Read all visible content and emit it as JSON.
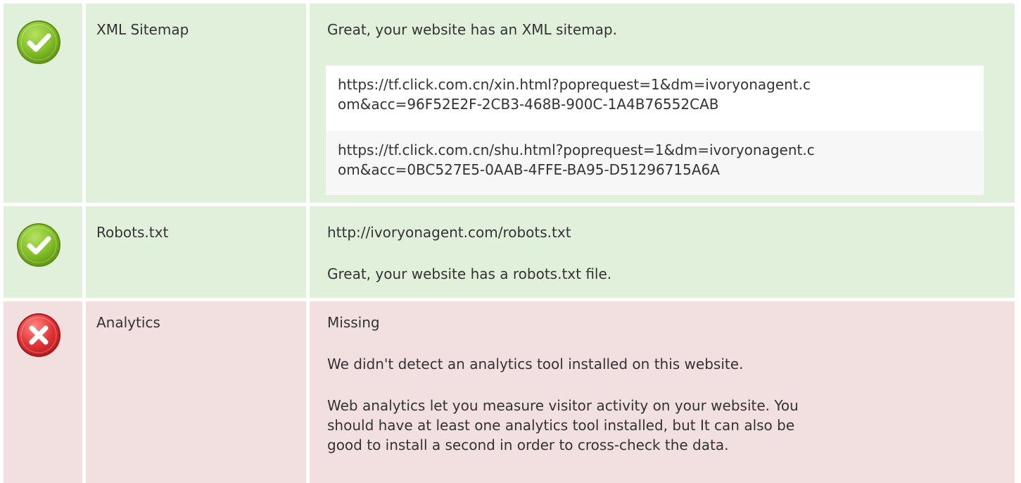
{
  "colors": {
    "pass_background": "#e0f0da",
    "fail_background": "#f2dfe0",
    "pass_icon": "#7ab51d",
    "fail_icon": "#e0383e",
    "text": "#333333"
  },
  "checks": [
    {
      "status": "pass",
      "icon": "check-circle-icon",
      "name": "XML Sitemap",
      "message": "Great, your website has an XML sitemap.",
      "urls": [
        {
          "line1": "https://tf.click.com.cn/xin.html?poprequest=1&dm=ivoryonagent.c",
          "line2": "om&acc=96F52E2F-2CB3-468B-900C-1A4B76552CAB"
        },
        {
          "line1": "https://tf.click.com.cn/shu.html?poprequest=1&dm=ivoryonagent.c",
          "line2": "om&acc=0BC527E5-0AAB-4FFE-BA95-D51296715A6A"
        }
      ]
    },
    {
      "status": "pass",
      "icon": "check-circle-icon",
      "name": "Robots.txt",
      "url": "http://ivoryonagent.com/robots.txt",
      "message": "Great, your website has a robots.txt file."
    },
    {
      "status": "fail",
      "icon": "cross-circle-icon",
      "name": "Analytics",
      "result": "Missing",
      "message": "We didn't detect an analytics tool installed on this website.",
      "advice": [
        "Web analytics let you measure visitor activity on your website. You",
        "should have at least one analytics tool installed, but It can also be",
        "good to install a second in order to cross-check the data."
      ]
    }
  ]
}
